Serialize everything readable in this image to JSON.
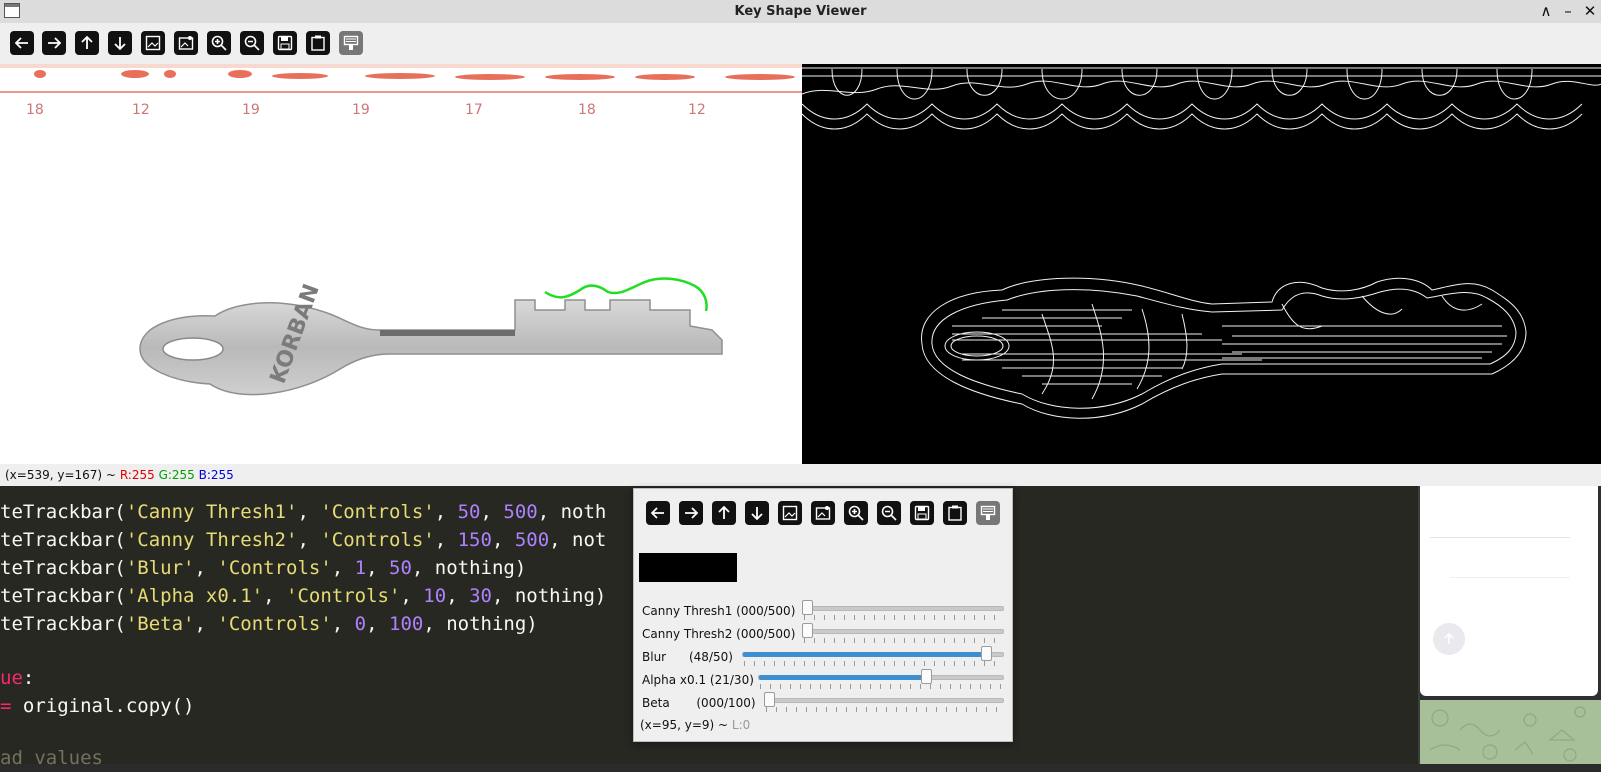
{
  "window": {
    "title": "Key Shape Viewer",
    "minimize_glyph": "∧",
    "restore_glyph": "–",
    "close_glyph": "✕"
  },
  "toolbar": {
    "buttons": [
      "arrow-left-icon",
      "arrow-right-icon",
      "arrow-up-icon",
      "arrow-down-icon",
      "image-icon",
      "image-annotate-icon",
      "zoom-in-icon",
      "zoom-out-icon",
      "save-icon",
      "clipboard-icon",
      "properties-icon"
    ]
  },
  "status": {
    "coords": "(x=539, y=167) ~",
    "r": "R:255",
    "g": "G:255",
    "b": "B:255"
  },
  "editor": {
    "lines": [
      {
        "pre": "teTrackbar(",
        "s1": "'Canny Thresh1'",
        "c1": ", ",
        "s2": "'Controls'",
        "c2": ", ",
        "n1": "50",
        "c3": ", ",
        "n2": "500",
        "post": ", noth"
      },
      {
        "pre": "teTrackbar(",
        "s1": "'Canny Thresh2'",
        "c1": ", ",
        "s2": "'Controls'",
        "c2": ", ",
        "n1": "150",
        "c3": ", ",
        "n2": "500",
        "post": ", not"
      },
      {
        "pre": "teTrackbar(",
        "s1": "'Blur'",
        "c1": ", ",
        "s2": "'Controls'",
        "c2": ", ",
        "n1": "1",
        "c3": ", ",
        "n2": "50",
        "post": ", nothing)"
      },
      {
        "pre": "teTrackbar(",
        "s1": "'Alpha x0.1'",
        "c1": ", ",
        "s2": "'Controls'",
        "c2": ", ",
        "n1": "10",
        "c3": ", ",
        "n2": "30",
        "post": ", nothing)"
      },
      {
        "pre": "teTrackbar(",
        "s1": "'Beta'",
        "c1": ", ",
        "s2": "'Controls'",
        "c2": ", ",
        "n1": "0",
        "c3": ", ",
        "n2": "100",
        "post": ", nothing)"
      }
    ],
    "line_ue": "ue",
    "line_ue_colon": ":",
    "line_copy_op": "=",
    "line_copy_rest": " original.copy()",
    "line_comment": "ad values"
  },
  "controls": {
    "trackbars": [
      {
        "label": "Canny Thresh1 (000/500)",
        "value": 0,
        "max": 500
      },
      {
        "label": "Canny Thresh2 (000/500)",
        "value": 0,
        "max": 500
      },
      {
        "label": "Blur      (48/50)",
        "value": 48,
        "max": 50
      },
      {
        "label": "Alpha x0.1 (21/30)",
        "value": 21,
        "max": 30
      },
      {
        "label": "Beta       (000/100)",
        "value": 0,
        "max": 100
      }
    ],
    "status_coords": "(x=95, y=9) ~",
    "status_lum": "L:0"
  },
  "colors": {
    "accent": "#3d8fd1",
    "status_r": "#e00000",
    "status_g": "#00b000",
    "status_b": "#0000e0"
  }
}
